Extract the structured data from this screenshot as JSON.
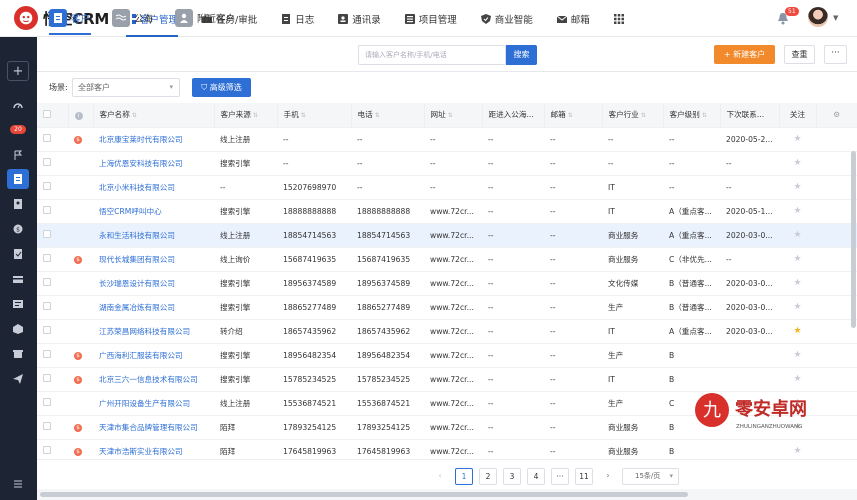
{
  "app": {
    "logo_text": "悟空CRM",
    "brand_color": "#d9302b",
    "accent": "#2e6fd6"
  },
  "nav": [
    {
      "label": "客户管理",
      "icon": "grid-icon",
      "active": true
    },
    {
      "label": "任务/审批",
      "icon": "briefcase-icon"
    },
    {
      "label": "日志",
      "icon": "log-icon"
    },
    {
      "label": "通讯录",
      "icon": "contacts-icon"
    },
    {
      "label": "项目管理",
      "icon": "project-icon"
    },
    {
      "label": "商业智能",
      "icon": "shield-icon"
    },
    {
      "label": "邮箱",
      "icon": "mail-icon"
    }
  ],
  "header": {
    "notification_count": "51"
  },
  "sidebar": {
    "badge": "20"
  },
  "tabs": [
    {
      "label": "客户",
      "active": true
    },
    {
      "label": "公海"
    },
    {
      "label": "附近客户"
    }
  ],
  "search": {
    "placeholder": "请输入客户名称/手机/电话",
    "button": "搜索"
  },
  "actions": {
    "new": "+ 新建客户",
    "reset": "查重",
    "more": "···"
  },
  "filter": {
    "scene_label": "场景:",
    "scene_value": "全部客户",
    "advanced": "高级筛选"
  },
  "table": {
    "columns": [
      "客户名称",
      "客户来源",
      "手机",
      "电话",
      "网址",
      "距进入公海...",
      "邮箱",
      "客户行业",
      "客户级别",
      "下次联系...",
      "关注"
    ],
    "rows": [
      {
        "dot": true,
        "name": "北京康宝莱时代有限公司",
        "source": "线上注册",
        "mobile": "--",
        "phone": "--",
        "url": "--",
        "days": "--",
        "email": "--",
        "industry": "--",
        "level": "--",
        "next": "2020-05-2...",
        "star": false
      },
      {
        "dot": false,
        "name": "上海优恩安科技有限公司",
        "source": "搜索引擎",
        "mobile": "--",
        "phone": "--",
        "url": "--",
        "days": "--",
        "email": "--",
        "industry": "--",
        "level": "--",
        "next": "--",
        "star": false
      },
      {
        "dot": false,
        "name": "北京小米科技有限公司",
        "source": "--",
        "mobile": "15207698970",
        "phone": "--",
        "url": "--",
        "days": "--",
        "email": "--",
        "industry": "IT",
        "level": "--",
        "next": "--",
        "star": false
      },
      {
        "dot": false,
        "name": "悟空CRM呼叫中心",
        "source": "搜索引擎",
        "mobile": "18888888888",
        "phone": "18888888888",
        "url": "www.72cr...",
        "days": "--",
        "email": "--",
        "industry": "IT",
        "level": "A（重点客...",
        "next": "2020-05-1...",
        "star": false
      },
      {
        "dot": false,
        "name": "永和生活科技有限公司",
        "source": "线上注册",
        "mobile": "18854714563",
        "phone": "18854714563",
        "url": "www.72cr...",
        "days": "--",
        "email": "--",
        "industry": "商业服务",
        "level": "A（重点客...",
        "next": "2020-03-0...",
        "star": false,
        "highlight": true
      },
      {
        "dot": true,
        "name": "现代长城集团有限公司",
        "source": "线上询价",
        "mobile": "15687419635",
        "phone": "15687419635",
        "url": "www.72cr...",
        "days": "--",
        "email": "--",
        "industry": "商业服务",
        "level": "C（非优先...",
        "next": "--",
        "star": false
      },
      {
        "dot": false,
        "name": "长沙瑞恩设计有限公司",
        "source": "搜索引擎",
        "mobile": "18956374589",
        "phone": "18956374589",
        "url": "www.72cr...",
        "days": "--",
        "email": "--",
        "industry": "文化传媒",
        "level": "B（普通客...",
        "next": "2020-03-0...",
        "star": false
      },
      {
        "dot": false,
        "name": "湖南金属冶炼有限公司",
        "source": "搜索引擎",
        "mobile": "18865277489",
        "phone": "18865277489",
        "url": "www.72cr...",
        "days": "--",
        "email": "--",
        "industry": "生产",
        "level": "B（普通客...",
        "next": "2020-03-0...",
        "star": false
      },
      {
        "dot": false,
        "name": "江苏荣昌网络科技有限公司",
        "source": "转介绍",
        "mobile": "18657435962",
        "phone": "18657435962",
        "url": "www.72cr...",
        "days": "--",
        "email": "--",
        "industry": "IT",
        "level": "A（重点客...",
        "next": "2020-03-0...",
        "star": true
      },
      {
        "dot": true,
        "name": "广西海利汇服装有限公司",
        "source": "搜索引擎",
        "mobile": "18956482354",
        "phone": "18956482354",
        "url": "www.72cr...",
        "days": "--",
        "email": "--",
        "industry": "生产",
        "level": "B",
        "next": "",
        "star": false
      },
      {
        "dot": true,
        "name": "北京三六一信息技术有限公司",
        "source": "搜索引擎",
        "mobile": "15785234525",
        "phone": "15785234525",
        "url": "www.72cr...",
        "days": "--",
        "email": "--",
        "industry": "IT",
        "level": "B",
        "next": "",
        "star": false
      },
      {
        "dot": false,
        "name": "广州开阳设备生产有限公司",
        "source": "线上注册",
        "mobile": "15536874521",
        "phone": "15536874521",
        "url": "www.72cr...",
        "days": "--",
        "email": "--",
        "industry": "生产",
        "level": "C",
        "next": "",
        "star": false
      },
      {
        "dot": true,
        "name": "天津市集合品牌管理有限公司",
        "source": "陌拜",
        "mobile": "17893254125",
        "phone": "17893254125",
        "url": "www.72cr...",
        "days": "--",
        "email": "--",
        "industry": "商业服务",
        "level": "B",
        "next": "",
        "star": false
      },
      {
        "dot": true,
        "name": "天津市浩斯实业有限公司",
        "source": "陌拜",
        "mobile": "17645819963",
        "phone": "17645819963",
        "url": "www.72cr...",
        "days": "--",
        "email": "--",
        "industry": "商业服务",
        "level": "B",
        "next": "",
        "star": false
      }
    ]
  },
  "pagination": {
    "pages": [
      "1",
      "2",
      "3",
      "4",
      "···",
      "11"
    ],
    "prev": "‹",
    "next": "›",
    "page_size": "15条/页"
  },
  "watermark": {
    "title": "零安卓网",
    "sub": "ZHULINGANZHUOWANG",
    "mark": "九"
  }
}
